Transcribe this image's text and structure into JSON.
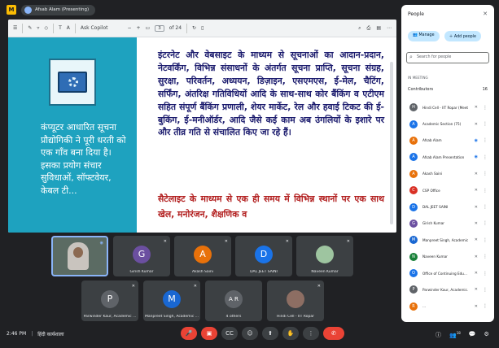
{
  "meet": {
    "presenter_label": "Afsab Alam (Presenting)",
    "time": "2:46 PM",
    "meeting_title": "हिंदी कार्यशाला"
  },
  "pdf_toolbar": {
    "ask_copilot": "Ask Copilot",
    "page_input": "3",
    "page_total": "of 24",
    "zoom_minus": "−",
    "zoom_plus": "+"
  },
  "slide": {
    "left_text": "कंप्यूटर आधारित सूचना प्रौद्योगिकी ने पूरी धरती को एक गाँव बना दिया है। इसका प्रयोग संचार सुविधाओं, सॉफ्टवेयर, केबल टी...",
    "main_text": "इंटरनेट और वेबसाइट के माध्यम से सूचनाओं का आदान-प्रदान, नेटवर्किंग, विभिन्न संसाधनों के अंतर्गत सूचना प्राप्ति, सूचना संग्रह, सुरक्षा, परिवर्तन, अध्ययन, डिज़ाइन, एसएमएस, ई-मेल, चैटिंग, सर्फिंग, अंतरिक्ष गतिविधियों आदि के साथ-साथ कोर बैंकिंग व एटीएम सहित संपूर्ण बैंकिंग प्रणाली, शेयर मार्केट, रेल और हवाई टिकट की ई-बुकिंग, ई-मनीऑर्डर, आदि जैसे कई काम अब उंगलियों के इशारे पर और तीव्र गति से संचालित किए जा रहे हैं।",
    "red_text": "सैटेलाइट के माध्यम से एक ही समय में विभिन्न स्थानों पर एक साथ खेल, मनोरंजन, शैक्षणिक व"
  },
  "tiles": [
    {
      "name": "",
      "initial": "",
      "color": "#5b6b63"
    },
    {
      "name": "Girish Kumar",
      "initial": "G",
      "color": "#6b4fa0"
    },
    {
      "name": "Akash Saini",
      "initial": "A",
      "color": "#e8710a"
    },
    {
      "name": "DAL JEET SAINI",
      "initial": "D",
      "color": "#1a73e8"
    },
    {
      "name": "Naveen Kumar",
      "initial": "",
      "color": "#3c4043"
    },
    {
      "name": "Parwinder Kaur, Academic ...",
      "initial": "P",
      "color": "#5f6368"
    },
    {
      "name": "Manpreet Singh, Academic ...",
      "initial": "M",
      "color": "#1967d2"
    },
    {
      "name": "4 others",
      "initial": "A R",
      "color": "#5f6368"
    },
    {
      "name": "Hindi Cell - IIT Ropar",
      "initial": "",
      "color": "#3c4043"
    }
  ],
  "people_panel": {
    "title": "People",
    "add_people": "Add people",
    "manage": "Manage",
    "search_placeholder": "Search for people",
    "in_meeting": "IN MEETING",
    "contributors": "Contributors",
    "contributors_count": "16",
    "people": [
      {
        "name": "Hindi Cell - IIT Ropar (Meeting host)",
        "initial": "H",
        "color": "#5f6368"
      },
      {
        "name": "Academic Section (75)",
        "initial": "A",
        "color": "#1a73e8"
      },
      {
        "name": "Afsab Alam",
        "initial": "A",
        "color": "#e8710a"
      },
      {
        "name": "Afsab Alam Presentation",
        "initial": "A",
        "color": "#1a73e8"
      },
      {
        "name": "Akash Saini",
        "initial": "A",
        "color": "#e8710a"
      },
      {
        "name": "CSP Office",
        "initial": "C",
        "color": "#d93025"
      },
      {
        "name": "DAL JEET SAINI",
        "initial": "D",
        "color": "#1a73e8"
      },
      {
        "name": "Girish Kumar",
        "initial": "G",
        "color": "#6b4fa0"
      },
      {
        "name": "Manpreet Singh, Academic...",
        "initial": "M",
        "color": "#1967d2"
      },
      {
        "name": "Naveen Kumar",
        "initial": "N",
        "color": "#188038"
      },
      {
        "name": "Office of Continuing Edu...",
        "initial": "O",
        "color": "#1a73e8"
      },
      {
        "name": "Parwinder Kaur, Academic...",
        "initial": "P",
        "color": "#5f6368"
      },
      {
        "name": "...",
        "initial": "R",
        "color": "#e8710a"
      }
    ]
  },
  "controls": {
    "mic": "🎤",
    "camera": "▣",
    "captions": "CC",
    "emoji": "☺",
    "present": "⬆",
    "raise_hand": "✋",
    "more": "⋮",
    "end_call": "✆",
    "info": "ⓘ",
    "people_count": "18",
    "chat": "💬",
    "activities": "⚙"
  }
}
